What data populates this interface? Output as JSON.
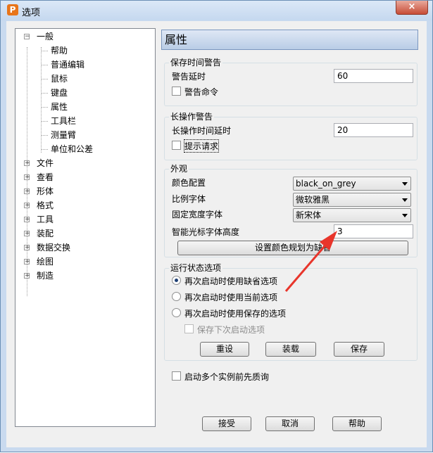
{
  "window": {
    "title": "选项",
    "app_icon": "P",
    "close_glyph": "×"
  },
  "tree": {
    "items": [
      {
        "label": "一般",
        "expander": "−"
      },
      {
        "label": "帮助"
      },
      {
        "label": "普通编辑"
      },
      {
        "label": "鼠标"
      },
      {
        "label": "键盘"
      },
      {
        "label": "属性",
        "selected": true
      },
      {
        "label": "工具栏"
      },
      {
        "label": "测量臂"
      },
      {
        "label": "单位和公差"
      },
      {
        "label": "文件",
        "expander": "+"
      },
      {
        "label": "查看",
        "expander": "+"
      },
      {
        "label": "形体",
        "expander": "+"
      },
      {
        "label": "格式",
        "expander": "+"
      },
      {
        "label": "工具",
        "expander": "+"
      },
      {
        "label": "装配",
        "expander": "+"
      },
      {
        "label": "数据交换",
        "expander": "+"
      },
      {
        "label": "绘图",
        "expander": "+"
      },
      {
        "label": "制造",
        "expander": "+"
      }
    ]
  },
  "panel": {
    "title": "属性",
    "save_warning": {
      "title": "保存时间警告",
      "delay_label": "警告延时",
      "delay_value": "60",
      "command_label": "警告命令"
    },
    "long_op": {
      "title": "长操作警告",
      "delay_label": "长操作时间延时",
      "delay_value": "20",
      "prompt_label": "提示请求"
    },
    "appearance": {
      "title": "外观",
      "color_label": "颜色配置",
      "color_value": "black_on_grey",
      "prop_font_label": "比例字体",
      "prop_font_value": "微软雅黑",
      "fixed_font_label": "固定宽度字体",
      "fixed_font_value": "新宋体",
      "cursor_font_label": "智能光标字体高度",
      "cursor_font_value": "3",
      "reset_color_label": "设置颜色规划为缺省"
    },
    "runtime": {
      "title": "运行状态选项",
      "options": [
        "再次启动时使用缺省选项",
        "再次启动时使用当前选项",
        "再次启动时使用保存的选项"
      ],
      "selected": 0,
      "save_next_label": "保存下次启动选项",
      "reset_label": "重设",
      "load_label": "装载",
      "save_label": "保存"
    },
    "multi_instance_label": "启动多个实例前先质询",
    "ok_label": "接受",
    "cancel_label": "取消",
    "help_label": "帮助"
  },
  "annotation": {
    "arrow_color": "#e8352b"
  }
}
